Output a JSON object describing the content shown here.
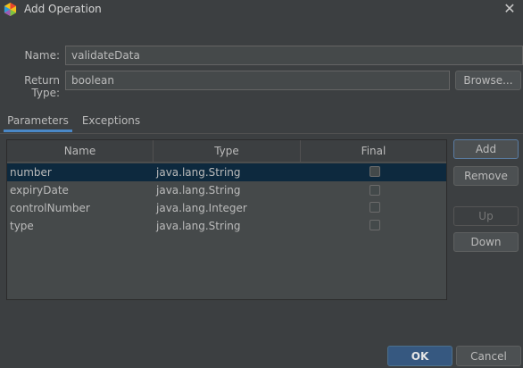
{
  "window": {
    "title": "Add Operation",
    "close_glyph": "✕"
  },
  "form": {
    "name_label": "Name:",
    "name_value": "validateData",
    "return_type_label": "Return Type:",
    "return_type_value": "boolean",
    "browse_label": "Browse..."
  },
  "tabs": [
    {
      "label": "Parameters",
      "selected": true
    },
    {
      "label": "Exceptions",
      "selected": false
    }
  ],
  "table": {
    "columns": [
      "Name",
      "Type",
      "Final"
    ],
    "rows": [
      {
        "name": "number",
        "type": "java.lang.String",
        "final": false,
        "selected": true
      },
      {
        "name": "expiryDate",
        "type": "java.lang.String",
        "final": false,
        "selected": false
      },
      {
        "name": "controlNumber",
        "type": "java.lang.Integer",
        "final": false,
        "selected": false
      },
      {
        "name": "type",
        "type": "java.lang.String",
        "final": false,
        "selected": false
      }
    ]
  },
  "side_buttons": {
    "add": "Add",
    "remove": "Remove",
    "up": "Up",
    "down": "Down"
  },
  "footer": {
    "ok": "OK",
    "cancel": "Cancel"
  },
  "colors": {
    "background": "#3c3f41",
    "selection": "#0d293e",
    "primary_button": "#365880",
    "tab_underline": "#4a88c7"
  }
}
